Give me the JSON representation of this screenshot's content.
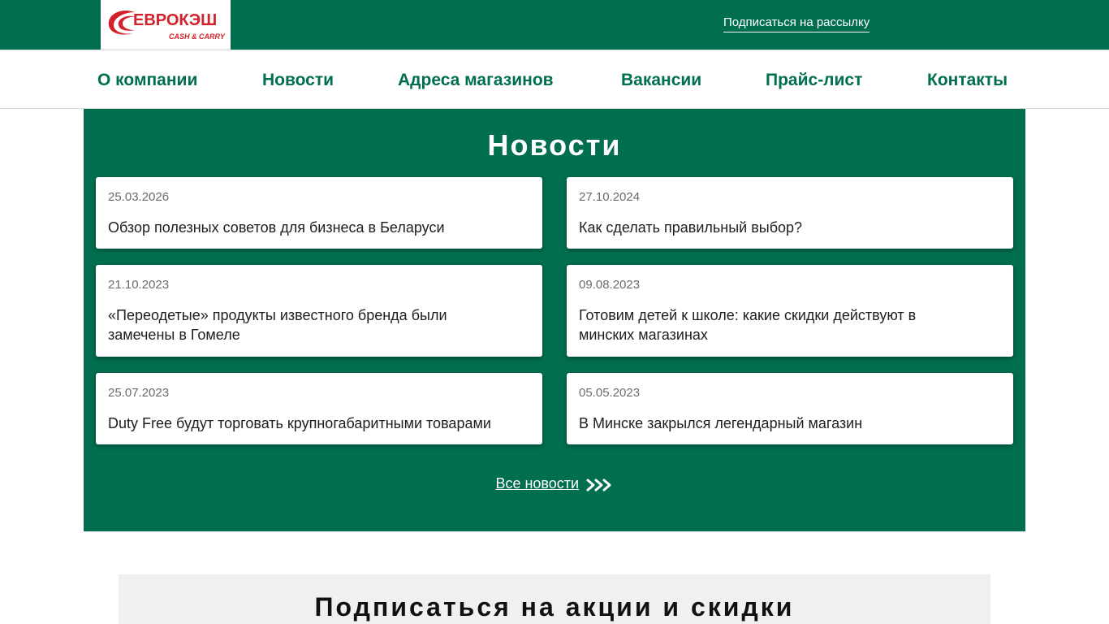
{
  "header": {
    "logo_text": "ЕВРОКЭШ",
    "logo_sub": "CASH & CARRY",
    "subscribe_link": "Подписаться на рассылку"
  },
  "nav": {
    "items": [
      {
        "label": "О компании"
      },
      {
        "label": "Новости"
      },
      {
        "label": "Адреса магазинов"
      },
      {
        "label": "Вакансии"
      },
      {
        "label": "Прайс-лист"
      },
      {
        "label": "Контакты"
      }
    ]
  },
  "news": {
    "heading": "Новости",
    "cards": [
      {
        "date": "25.03.2026",
        "title": "Обзор полезных советов для бизнеса в Беларуси"
      },
      {
        "date": "27.10.2024",
        "title": "Как сделать правильный выбор?"
      },
      {
        "date": "21.10.2023",
        "title": "«Переодетые» продукты известного бренда были замечены в Гомеле"
      },
      {
        "date": "09.08.2023",
        "title": "Готовим детей к школе: какие скидки действуют в минских магазинах"
      },
      {
        "date": "25.07.2023",
        "title": "Duty Free будут торговать крупногабаритными товарами"
      },
      {
        "date": "05.05.2023",
        "title": "В Минске закрылся легендарный магазин"
      }
    ],
    "all_news_link": "Все новости"
  },
  "subscribe": {
    "heading": "Подписаться на акции и скидки"
  },
  "colors": {
    "brand_green": "#006e4f",
    "logo_red": "#d4202a"
  }
}
